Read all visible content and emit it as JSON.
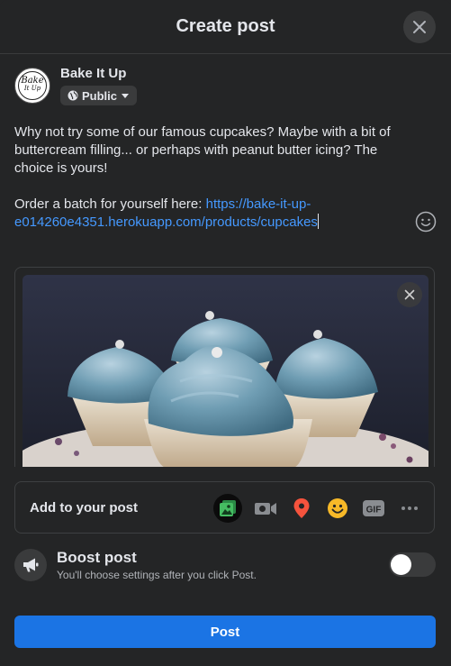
{
  "header": {
    "title": "Create post"
  },
  "user": {
    "name": "Bake It Up",
    "avatar_text_line1": "Bake",
    "avatar_text_line2": "It Up",
    "privacy_label": "Public"
  },
  "post": {
    "text": "Why not try some of our famous cupcakes? Maybe with a bit of buttercream filling... or perhaps with peanut butter icing? The choice is yours!\n\nOrder a batch for yourself here: ",
    "link": "https://bake-it-up-e014260e4351.herokuapp.com/products/cupcakes"
  },
  "add_to_post": {
    "label": "Add to your post",
    "icons": [
      "photo-video-icon",
      "video-camera-icon",
      "location-pin-icon",
      "feeling-emoji-icon",
      "gif-icon",
      "more-icon"
    ],
    "gif_text": "GIF",
    "colors": {
      "photo": "#45bd62",
      "location": "#f5533d",
      "feeling": "#f7b928"
    }
  },
  "boost": {
    "title": "Boost post",
    "description": "You'll choose settings after you click Post.",
    "enabled": false
  },
  "post_button": {
    "label": "Post"
  },
  "colors": {
    "accent": "#1b74e4",
    "link": "#4599ff",
    "surface": "#242526"
  }
}
